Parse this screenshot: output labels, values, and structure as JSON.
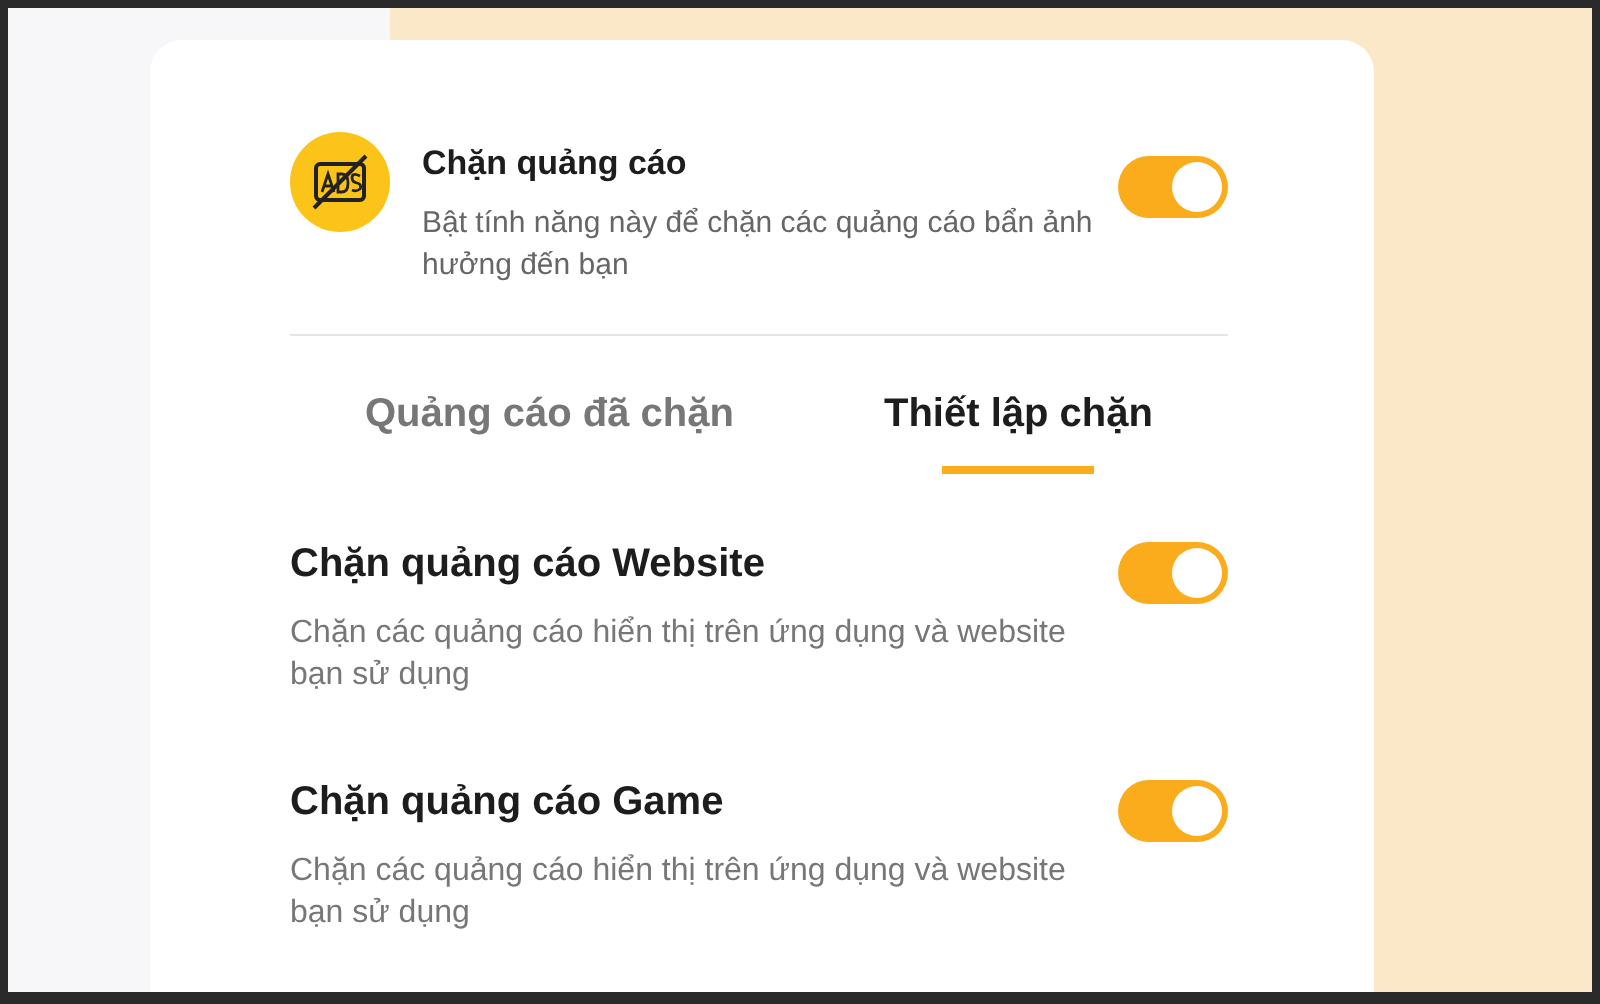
{
  "header": {
    "title": "Chặn quảng cáo",
    "description": "Bật tính năng này để chặn các quảng cáo bẩn ảnh hưởng đến bạn",
    "on": true
  },
  "tabs": [
    {
      "label": "Quảng cáo đã chặn",
      "selected": false
    },
    {
      "label": "Thiết lập chặn",
      "selected": true
    }
  ],
  "settings": [
    {
      "title": "Chặn quảng cáo Website",
      "description": "Chặn các quảng cáo hiển thị trên ứng dụng và website bạn sử dụng",
      "on": true
    },
    {
      "title": "Chặn quảng cáo Game",
      "description": "Chặn các quảng cáo hiển thị trên ứng dụng và website bạn sử dụng",
      "on": true
    }
  ]
}
